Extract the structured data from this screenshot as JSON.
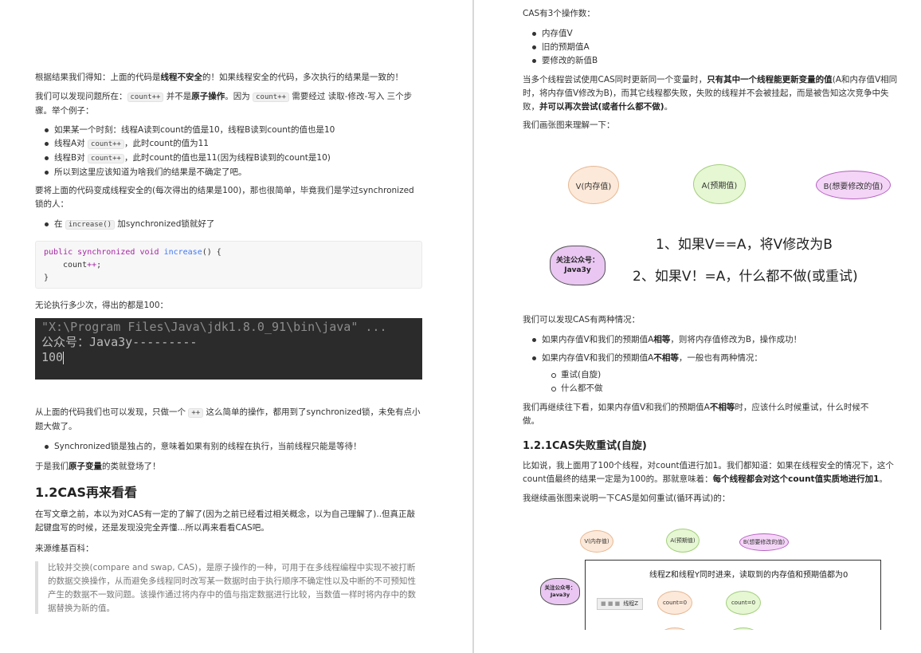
{
  "left": {
    "p1": {
      "a": "根据结果我们得知：上面的代码是",
      "b": "线程不安全",
      "c": "的！如果线程安全的代码，多次执行的结果是一致的！"
    },
    "p2": {
      "a": "我们可以发现问题所在：",
      "code1": "count++",
      "b": " 并不是",
      "c": "原子操作",
      "d": "。因为 ",
      "code2": "count++",
      "e": " 需要经过 读取-修改-写入 三个步",
      "f": "骤。举个例子："
    },
    "list1": [
      "如果某一个时刻：线程A读到count的值是10，线程B读到count的值也是10",
      [
        "线程A对 ",
        "count++",
        "，此时count的值为11"
      ],
      [
        "线程B对 ",
        "count++",
        "，此时count的值也是11(因为线程B读到的count是10)"
      ],
      "所以到这里应该知道为啥我们的结果是不确定了吧。"
    ],
    "p3a": "要将上面的代码变成线程安全的(每次得出的结果是100)，那也很简单，毕竟我们是学过synchronized",
    "p3b": "锁的人：",
    "list2": {
      "a": "在 ",
      "code": "increase()",
      "b": " 加synchronized锁就好了"
    },
    "code": {
      "l1a": "public",
      "l1b": "synchronized",
      "l1c": "void",
      "l1d": "increase",
      "l1e": "() {",
      "l2a": "count",
      "l2b": "++",
      "l2c": ";",
      "l3": "}"
    },
    "p4": "无论执行多少次，得出的都是100：",
    "terminal": {
      "line1": "\"X:\\Program Files\\Java\\jdk1.8.0_91\\bin\\java\" ...",
      "line2": "公众号：Java3y---------",
      "line3": "100"
    },
    "p5a": {
      "a": "从上面的代码我们也可以发现，只做一个 ",
      "code": "++",
      "b": " 这么简单的操作，都用到了synchronized锁，未免有点小"
    },
    "p5b": "题大做了。",
    "list3": "Synchronized锁是独占的，意味着如果有别的线程在执行，当前线程只能是等待！",
    "p6": {
      "a": "于是我们",
      "b": "原子变量",
      "c": "的类就登场了！"
    },
    "h2": "1.2CAS再来看看",
    "p7a": "在写文章之前，本以为对CAS有一定的了解了(因为之前已经看过相关概念，以为自己理解了)..但真正敲",
    "p7b": "起键盘写的时候，还是发现没完全弄懂...所以再来看看CAS吧。",
    "p8": "来源维基百科：",
    "quote": "比较并交换(compare and swap, CAS)，是原子操作的一种，可用于在多线程编程中实现不被打断的数据交换操作，从而避免多线程同时改写某一数据时由于执行顺序不确定性以及中断的不可预知性产生的数据不一致问题。该操作通过将内存中的值与指定数据进行比较，当数值一样时将内存中的数据替换为新的值。"
  },
  "right": {
    "p1": "CAS有3个操作数：",
    "list1": [
      "内存值V",
      "旧的预期值A",
      "要修改的新值B"
    ],
    "p2": {
      "a": "当多个线程尝试使用CAS同时更新同一个变量时，",
      "b": "只有其中一个线程能更新变量的值",
      "c": "(A和内存值V相同",
      "d": "时，将内存值V修改为B)，而其它线程都失败，失败的线程并不会被挂起，而是被告知这次竞争中失",
      "e": "败，",
      "f": "并可以再次尝试(或者什么都不做)",
      "g": "。"
    },
    "p3": "我们画张图来理解一下：",
    "diagram1": {
      "v": "V(内存值)",
      "a": "A(预期值)",
      "b": "B(想要修改的值)",
      "line1": "1、如果V==A，将V修改为B",
      "line2": "2、如果V！=A，什么都不做(或重试)",
      "cloud": "关注公众号：\nJava3y"
    },
    "p4": "我们可以发现CAS有两种情况：",
    "list2": [
      {
        "a": "如果内存值V和我们的预期值A",
        "b": "相等",
        "c": "，则将内存值修改为B，操作成功！"
      },
      {
        "a": "如果内存值V和我们的预期值A",
        "b": "不相等",
        "c": "，一般也有两种情况："
      }
    ],
    "list3": [
      "重试(自旋)",
      "什么都不做"
    ],
    "p5": {
      "a": "我们再继续往下看，如果内存值V和我们的预期值A",
      "b": "不相等",
      "c": "时，应该什么时候重试，什么时候不",
      "d": "做。"
    },
    "h3": "1.2.1CAS失败重试(自旋)",
    "p6": {
      "a": "比如说，我上面用了100个线程，对count值进行加1。我们都知道：如果在线程安全的情况下，这个",
      "b": "count值最终的结果一定是为100的。那就意味着：",
      "c": "每个线程都会对这个count值实质地进行加1",
      "d": "。"
    },
    "p7": "我继续画张图来说明一下CAS是如何重试(循环再试)的：",
    "diagram2": {
      "v": "V(内存值)",
      "a": "A(预期值)",
      "b": "B(想要修改的值)",
      "cloud": "关注公众号：\nJava3y",
      "caption": "线程Z和线程Y同时进来，读取到的内存值和预期值都为0",
      "thread": "线程Z",
      "count1": "count=0",
      "count2": "count=0"
    }
  },
  "colors": {
    "v": "#fde9d9",
    "a": "#e6f7d3",
    "b": "#f4d5f7",
    "cloud": "#e9c7f2"
  }
}
